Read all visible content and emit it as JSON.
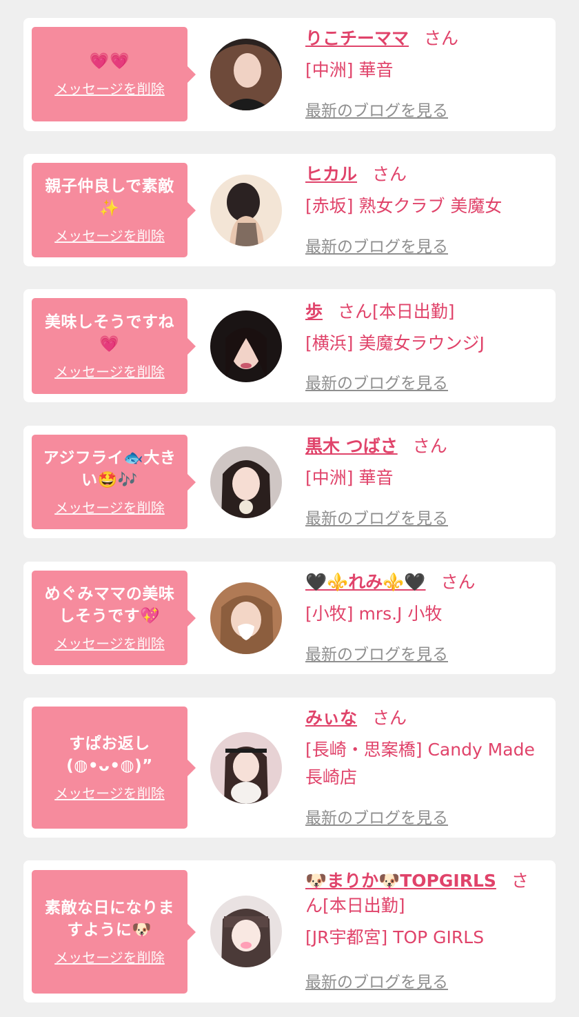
{
  "labels": {
    "delete": "メッセージを削除",
    "blog": "最新のブログを見る",
    "honorific": "さん",
    "on_duty": "[本日出勤]"
  },
  "cards": [
    {
      "message": "💗💗",
      "name": "りこチーママ",
      "shop": "[中洲] 華音"
    },
    {
      "message": "親子仲良しで素敵✨",
      "name": "ヒカル",
      "shop": "[赤坂] 熟女クラブ 美魔女"
    },
    {
      "message": "美味しそうですね💗",
      "name": "歩",
      "shop": "[横浜] 美魔女ラウンジJ"
    },
    {
      "message": "アジフライ🐟大きい🤩🎶",
      "name": "黒木 つばさ",
      "shop": "[中洲] 華音"
    },
    {
      "message": "めぐみママの美味しそうです💖",
      "name": "🖤⚜️れみ⚜️🖤",
      "shop": "[小牧] mrs.J 小牧"
    },
    {
      "message": "すぱお返し(◍•ᴗ•◍)”",
      "name": "みぃな",
      "shop": "[長崎・思案橋] Candy Made 長崎店"
    },
    {
      "message": "素敵な日になりますように🐶",
      "name": "🐶まりか🐶TOPGIRLS",
      "shop": "[JR宇都宮] TOP GIRLS"
    }
  ]
}
